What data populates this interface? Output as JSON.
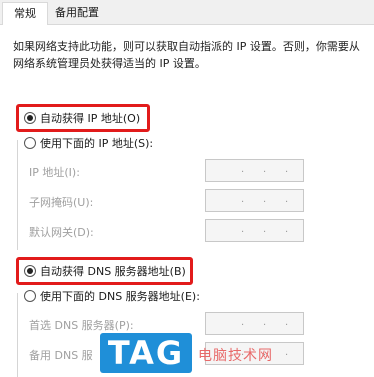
{
  "tabs": [
    {
      "label": "常规",
      "active": true
    },
    {
      "label": "备用配置",
      "active": false
    }
  ],
  "description": "如果网络支持此功能，则可以获取自动指派的 IP 设置。否则，你需要从网络系统管理员处获得适当的 IP 设置。",
  "ip_section": {
    "auto_label": "自动获得 IP 地址(O)",
    "auto_selected": true,
    "manual_label": "使用下面的 IP 地址(S):",
    "manual_selected": false,
    "fields": [
      {
        "label": "IP 地址(I):",
        "value": ". . ."
      },
      {
        "label": "子网掩码(U):",
        "value": ". . ."
      },
      {
        "label": "默认网关(D):",
        "value": ". . ."
      }
    ]
  },
  "dns_section": {
    "auto_label": "自动获得 DNS 服务器地址(B)",
    "auto_selected": true,
    "manual_label": "使用下面的 DNS 服务器地址(E):",
    "manual_selected": false,
    "fields": [
      {
        "label": "首选 DNS 服务器(P):",
        "value": ". . ."
      },
      {
        "label": "备用 DNS 服",
        "value": ". . ."
      }
    ]
  },
  "watermark": {
    "logo_text": "TAG",
    "site_text": "电脑技术网",
    "logo_color": "#1f8fd8"
  },
  "highlight_color": "#e21b1b"
}
